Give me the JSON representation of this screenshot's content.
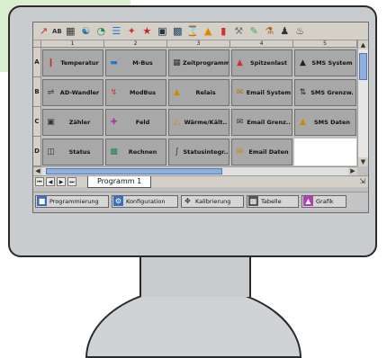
{
  "toolbar": {
    "text_label": "AB",
    "icons": [
      "cursor-icon",
      "text-icon",
      "grid-icon",
      "network-icon",
      "gauge-icon",
      "chart-icon",
      "wand-icon",
      "plug-icon",
      "monitor-icon",
      "calendar-icon",
      "clock-icon",
      "paint-icon",
      "chart-bar-icon",
      "tools-icon",
      "ruler-icon",
      "connect-icon",
      "people-icon",
      "thermo-icon"
    ]
  },
  "grid": {
    "columns": [
      "1",
      "2",
      "3",
      "4",
      "5"
    ],
    "rows": [
      {
        "label": "A",
        "cells": [
          {
            "text": "Temperatur",
            "icon": "thermometer-icon"
          },
          {
            "text": "M-Bus",
            "icon": "m-bus-icon"
          },
          {
            "text": "Zeitprogramm",
            "icon": "calendar-icon"
          },
          {
            "text": "Spitzenlast",
            "icon": "peak-load-icon"
          },
          {
            "text": "SMS System",
            "icon": "sms-icon"
          }
        ]
      },
      {
        "label": "B",
        "cells": [
          {
            "text": "AD-Wandler",
            "icon": "ad-converter-icon"
          },
          {
            "text": "ModBus",
            "icon": "modbus-icon"
          },
          {
            "text": "Relais",
            "icon": "relay-icon"
          },
          {
            "text": "Email System",
            "icon": "email-icon"
          },
          {
            "text": "SMS Grenzw.",
            "icon": "sms-limit-icon"
          }
        ]
      },
      {
        "label": "C",
        "cells": [
          {
            "text": "Zähler",
            "icon": "counter-icon"
          },
          {
            "text": "Feld",
            "icon": "field-icon"
          },
          {
            "text": "Wärme/Kält..",
            "icon": "heat-cold-icon"
          },
          {
            "text": "Email Grenz..",
            "icon": "email-limit-icon"
          },
          {
            "text": "SMS Daten",
            "icon": "sms-data-icon"
          }
        ]
      },
      {
        "label": "D",
        "cells": [
          {
            "text": "Status",
            "icon": "status-icon"
          },
          {
            "text": "Rechnen",
            "icon": "calculator-icon"
          },
          {
            "text": "Statusintegr..",
            "icon": "status-integral-icon"
          },
          {
            "text": "Email Daten",
            "icon": "email-data-icon"
          }
        ]
      }
    ]
  },
  "sheet": {
    "tab_label": "Programm 1"
  },
  "statusbar": {
    "tabs": [
      {
        "label": "Programmierung",
        "icon": "program-icon"
      },
      {
        "label": "Konfiguration",
        "icon": "config-icon"
      },
      {
        "label": "Kalibrierung",
        "icon": "calibration-icon"
      },
      {
        "label": "Tabelle",
        "icon": "table-icon"
      },
      {
        "label": "Grafik",
        "icon": "graph-icon"
      }
    ]
  }
}
